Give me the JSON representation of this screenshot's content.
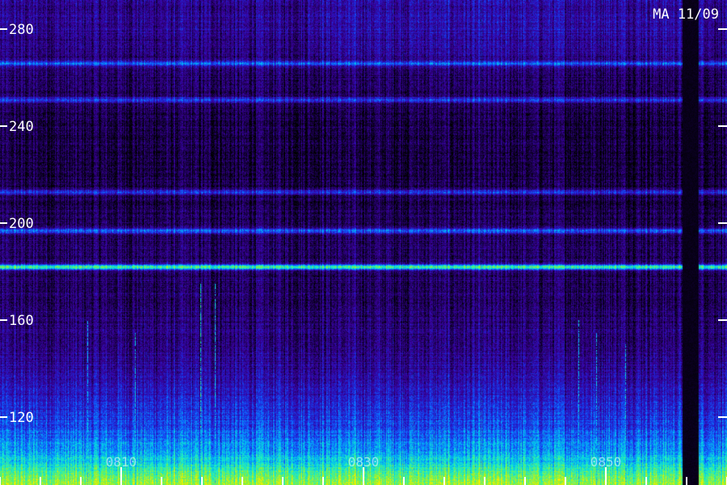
{
  "chart_data": {
    "type": "heatmap",
    "title": "MA 11/09",
    "ylabel": "",
    "xlabel": "",
    "ylim": [
      92,
      292
    ],
    "y_ticks": [
      {
        "value": 280,
        "label": "280"
      },
      {
        "value": 240,
        "label": "240"
      },
      {
        "value": 200,
        "label": "200"
      },
      {
        "value": 160,
        "label": "160"
      },
      {
        "value": 120,
        "label": "120"
      }
    ],
    "x_tick_labels": [
      "0810",
      "0830",
      "0850"
    ],
    "colormap": [
      "#000000",
      "#1a0050",
      "#3a0098",
      "#2020d0",
      "#1060ff",
      "#00c0f0",
      "#20f0c0",
      "#80f040",
      "#f0f000"
    ],
    "horizontal_bands": [
      {
        "y": 182,
        "intensity": 0.62
      },
      {
        "y": 197,
        "intensity": 0.35
      },
      {
        "y": 213,
        "intensity": 0.3
      },
      {
        "y": 251,
        "intensity": 0.28
      },
      {
        "y": 266,
        "intensity": 0.3
      }
    ],
    "vertical_spikes": [
      {
        "x": 0.275,
        "y_top": 175,
        "intensity": 0.7
      },
      {
        "x": 0.295,
        "y_top": 175,
        "intensity": 0.5
      },
      {
        "x": 0.185,
        "y_top": 155,
        "intensity": 0.45
      },
      {
        "x": 0.12,
        "y_top": 160,
        "intensity": 0.4
      },
      {
        "x": 0.795,
        "y_top": 160,
        "intensity": 0.45
      },
      {
        "x": 0.86,
        "y_top": 150,
        "intensity": 0.5
      },
      {
        "x": 0.82,
        "y_top": 155,
        "intensity": 0.4
      }
    ],
    "data_gap": {
      "x_start": 0.938,
      "x_end": 0.96
    }
  },
  "colors": {
    "axis": "#ffffff",
    "title": "#ffffff",
    "background": "#000000"
  }
}
